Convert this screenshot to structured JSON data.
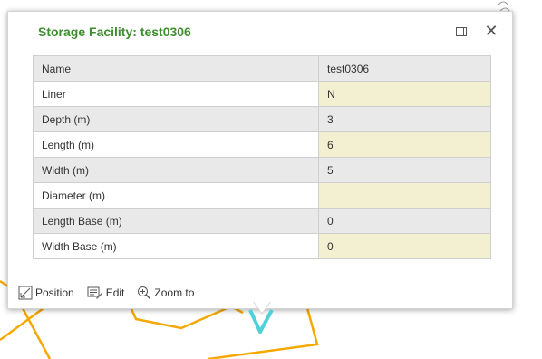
{
  "popup": {
    "title": "Storage Facility: test0306",
    "rows": [
      {
        "key": "Name",
        "value": "test0306",
        "editable": false
      },
      {
        "key": "Liner",
        "value": "N",
        "editable": true
      },
      {
        "key": "Depth (m)",
        "value": "3",
        "editable": false
      },
      {
        "key": "Length (m)",
        "value": "6",
        "editable": true
      },
      {
        "key": "Width (m)",
        "value": "5",
        "editable": false
      },
      {
        "key": "Diameter (m)",
        "value": "",
        "editable": true
      },
      {
        "key": "Length Base (m)",
        "value": "0",
        "editable": false
      },
      {
        "key": "Width Base (m)",
        "value": "0",
        "editable": true
      }
    ]
  },
  "actions": {
    "position_label": "Position",
    "edit_label": "Edit",
    "zoom_label": "Zoom to"
  },
  "colors": {
    "title": "#3e8e2f",
    "map_lines": "#f5a800",
    "marker": "#4fd1d9",
    "editable_cell": "#f3f0d1"
  }
}
